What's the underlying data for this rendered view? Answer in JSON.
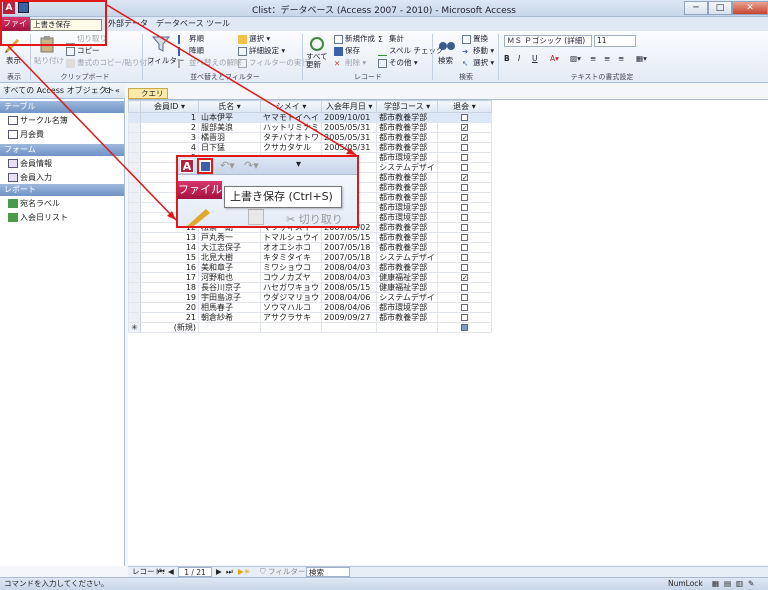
{
  "window": {
    "title": "Clist：データベース (Access 2007 - 2010) - Microsoft Access",
    "minimize": "─",
    "maximize": "□",
    "close": "✕"
  },
  "ribbon_tabs": {
    "file": "ファイル",
    "external": "外部データ",
    "dbtools": "データベース ツール"
  },
  "ribbon": {
    "view": "表示",
    "paste": "貼り付け",
    "cut": "切り取り",
    "copy": "コピー",
    "format_painter": "書式のコピー/貼り付け",
    "filter": "フィルター",
    "asc": "昇順",
    "desc": "降順",
    "remove_sort": "並べ替えの解除",
    "select": "選択",
    "advanced": "詳細設定",
    "toggle_filter": "フィルターの実行",
    "refresh": "すべて\n更新",
    "new": "新規作成",
    "save": "保存",
    "delete": "削除",
    "totals": "集計",
    "spelling": "スペル チェック",
    "more": "その他",
    "find": "検索",
    "replace": "置換",
    "goto": "移動",
    "select2": "選択",
    "font": "ＭＳ Ｐゴシック (詳細)",
    "font_size": "11",
    "groups": {
      "view": "表示",
      "clipboard": "クリップボード",
      "sort": "並べ替えとフィルター",
      "records": "レコード",
      "find": "検索",
      "text": "テキストの書式設定"
    }
  },
  "tooltip": "上書き保存 (Ctrl+S)",
  "zoom": {
    "file": "ファイル",
    "cut": "切り取り"
  },
  "nav": {
    "header": "すべての Access オブジェクト",
    "categories": {
      "tables": "テーブル",
      "forms": "フォーム",
      "reports": "レポート"
    },
    "tables": [
      "サークル名簿",
      "月会費"
    ],
    "forms": [
      "会員情報",
      "会員入力"
    ],
    "reports": [
      "宛名ラベル",
      "入会日リスト"
    ]
  },
  "query_tab": "クエリ1",
  "columns": [
    "会員ID",
    "氏名",
    "シメイ",
    "入会年月日",
    "学部コース",
    "退会"
  ],
  "rows": [
    [
      "1",
      "山本伊平",
      "ヤマモトイヘイ",
      "2009/10/01",
      "都市教養学部",
      false
    ],
    [
      "2",
      "服部美浪",
      "ハットリミナミ",
      "2005/05/31",
      "都市教養学部",
      true
    ],
    [
      "3",
      "橘晋羽",
      "タチバナオトワ",
      "2005/05/31",
      "都市教養学部",
      true
    ],
    [
      "4",
      "日下猛",
      "クサカタケル",
      "2005/05/31",
      "都市教養学部",
      false
    ],
    [
      "5",
      "",
      "",
      "",
      "都市環境学部",
      false
    ],
    [
      "6",
      "",
      "",
      "",
      "システムデザイ",
      false
    ],
    [
      "7",
      "",
      "",
      "",
      "都市教養学部",
      true
    ],
    [
      "8",
      "",
      "",
      "",
      "都市教養学部",
      false
    ],
    [
      "9",
      "",
      "",
      "",
      "都市教養学部",
      false
    ],
    [
      "10",
      "",
      "",
      "",
      "都市環境学部",
      false
    ],
    [
      "11",
      "",
      "",
      "",
      "都市環境学部",
      false
    ],
    [
      "12",
      "松崇一朗",
      "マツザキスイ",
      "2007/05/02",
      "都市教養学部",
      false
    ],
    [
      "13",
      "戸丸秀一",
      "トマルシュウイ",
      "2007/05/15",
      "都市教養学部",
      false
    ],
    [
      "14",
      "大江志保子",
      "オオエシホコ",
      "2007/05/18",
      "都市教養学部",
      false
    ],
    [
      "15",
      "北見大樹",
      "キタミタイキ",
      "2007/05/18",
      "システムデザイ",
      false
    ],
    [
      "16",
      "美和章子",
      "ミワショウコ",
      "2008/04/03",
      "都市教養学部",
      false
    ],
    [
      "17",
      "河野和也",
      "コウノカズヤ",
      "2008/04/03",
      "健康福祉学部",
      true
    ],
    [
      "18",
      "長谷川京子",
      "ハセガワキョウ",
      "2008/05/15",
      "健康福祉学部",
      false
    ],
    [
      "19",
      "宇田島涼子",
      "ウダジマリョウ",
      "2008/04/06",
      "システムデザイ",
      false
    ],
    [
      "20",
      "相馬春子",
      "ソウマハルコ",
      "2008/04/06",
      "都市環境学部",
      false
    ],
    [
      "21",
      "朝倉紗希",
      "アサクラサキ",
      "2009/09/27",
      "都市教養学部",
      false
    ]
  ],
  "new_row": "(新規)",
  "new_row_marker": "✳",
  "record_nav": {
    "label": "レコード:",
    "position": "1 / 21",
    "filter": "フィルターなし",
    "search": "検索"
  },
  "status": {
    "left": "コマンドを入力してください。",
    "numlock": "NumLock"
  }
}
